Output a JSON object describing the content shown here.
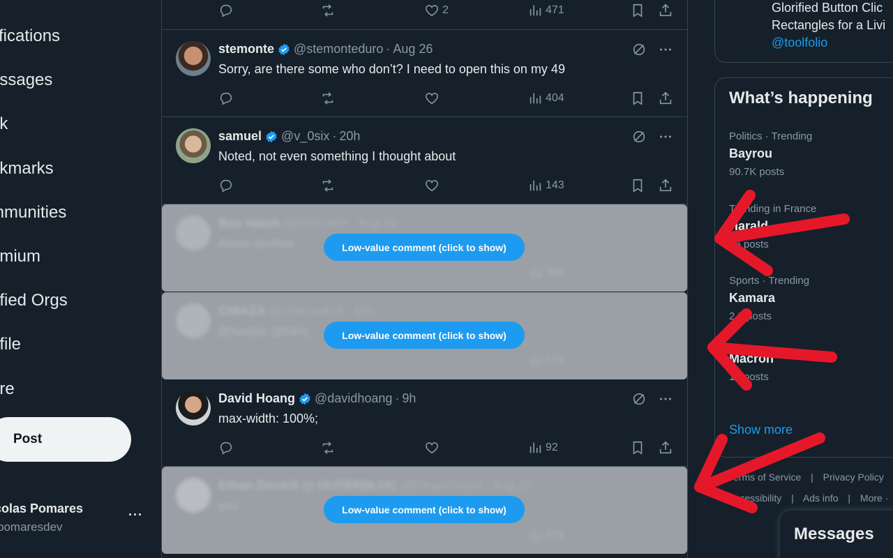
{
  "nav": {
    "notifications": "tifications",
    "messages": "essages",
    "grok": "ok",
    "bookmarks": "okmarks",
    "communities": "mmunities",
    "premium": "emium",
    "verified_orgs": "rified Orgs",
    "profile": "ofile",
    "more": "ore",
    "post": "Post"
  },
  "account": {
    "name": "colas Pomares",
    "handle": "pomaresdev",
    "more": "···"
  },
  "top_tweet": {
    "views": "471",
    "likes": "2"
  },
  "tweets": [
    {
      "name": "stemonte",
      "handle": "@stemonteduro",
      "sep": "·",
      "time": "Aug 26",
      "text": "Sorry, are there some who don’t? I need to open this on my 49",
      "views": "404"
    },
    {
      "name": "samuel",
      "handle": "@v_0six",
      "sep": "·",
      "time": "20h",
      "text": "Noted, not even something I thought about",
      "views": "143"
    },
    {
      "name": "David Hoang",
      "handle": "@davidhoang",
      "sep": "·",
      "time": "9h",
      "text": "max-width: 100%;",
      "views": "92"
    }
  ],
  "hidden_tweets": [
    {
      "name": "Ben Hatch",
      "handle": "@b3nhatch",
      "sep": "·",
      "time": "Aug 26",
      "text": "Amen brother",
      "views": "303",
      "button": "Low-value comment (click to show)"
    },
    {
      "name": "CHIAZA",
      "handle": "@chiazaokoli",
      "sep": "·",
      "time": "16h",
      "text": "@tunjilat @t3ch_",
      "views": "174",
      "button": "Low-value comment (click to show)"
    },
    {
      "name": "Ethan Driskill @ OUTERBLOC",
      "handle": "@EthanDriskill",
      "sep": "·",
      "time": "Aug 26",
      "text": "yes",
      "views": "376",
      "button": "Low-value comment (click to show)"
    }
  ],
  "right": {
    "card_top": {
      "line1": "Glorified Button Clic",
      "line2": "Rectangles for a Livi",
      "link": "@toolfolio"
    },
    "happening_title": "What’s happening",
    "trends": [
      {
        "meta": "Politics · Trending",
        "title": "Bayrou",
        "count": "90.7K posts"
      },
      {
        "meta": "Trending in France",
        "title": "Harald",
        "count": "16 posts"
      },
      {
        "meta": "Sports · Trending",
        "title": "Kamara",
        "count": "2.9 posts"
      },
      {
        "meta": "",
        "title": "Macron",
        "count": "16 posts"
      }
    ],
    "show_more": "Show more",
    "footer": [
      "Terms of Service",
      "|",
      "Privacy Policy",
      "|",
      "Accessibility",
      "|",
      "Ads info",
      "|",
      "More ·"
    ],
    "messages": "Messages"
  },
  "colors": {
    "bg": "#15202b",
    "accent": "#1d9bf0",
    "annotation_red": "#e5182a",
    "hidden_bg": "#9aa0a6"
  }
}
